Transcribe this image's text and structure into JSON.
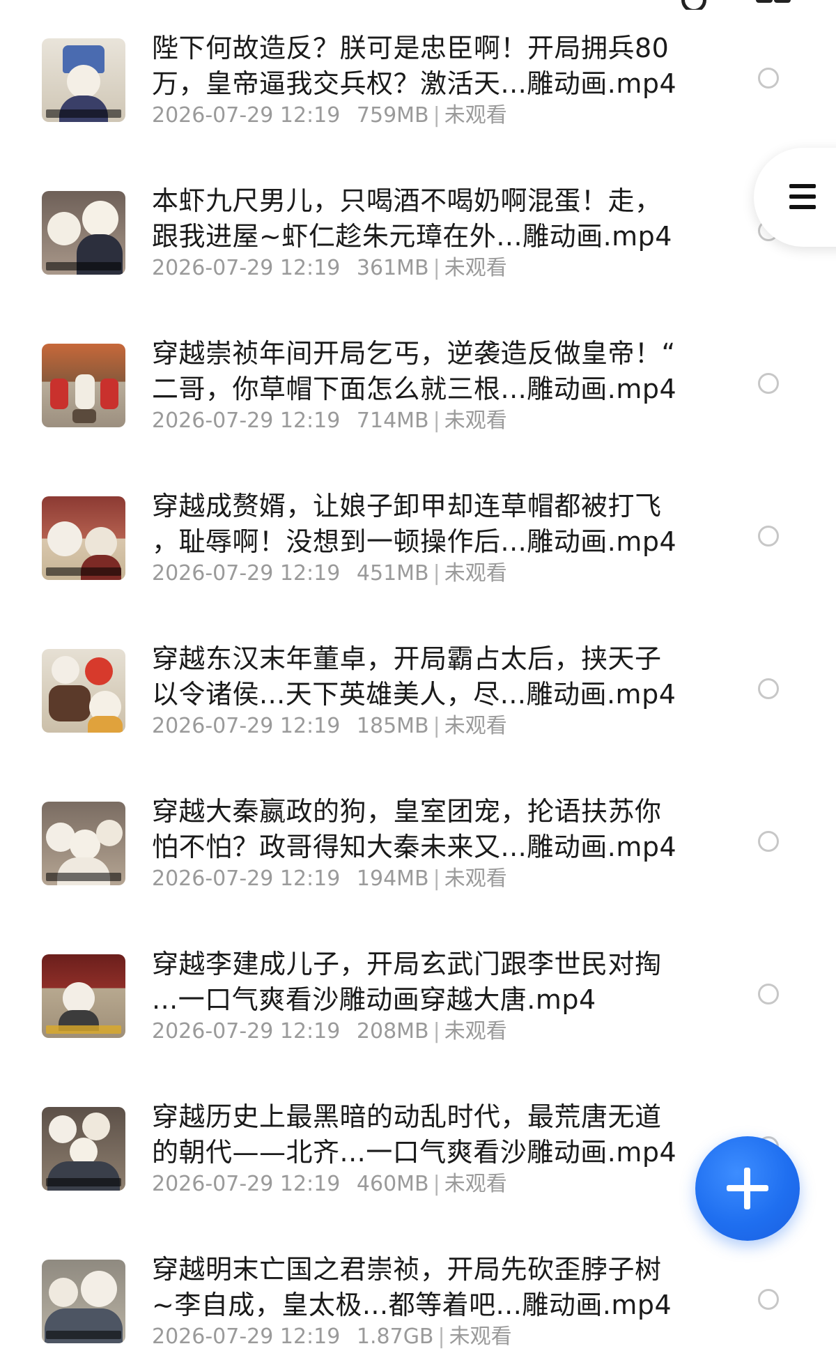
{
  "colors": {
    "title_text": "#1a1a1a",
    "meta_text": "#9a9a9a",
    "radio_border": "#c7c7c7",
    "fab_blue": "#1f6ff0"
  },
  "icons": {
    "side_menu": "menu-icon",
    "fab": "plus-icon",
    "top_search": "search-icon",
    "top_grid": "grid-icon"
  },
  "files": [
    {
      "title_line1": "陛下何故造反？朕可是忠臣啊！开局拥兵80",
      "title_line2": "万，皇帝逼我交兵权？激活天...雕动画.mp4",
      "date": "2026-07-29 12:19",
      "size": "759MB",
      "status": "未观看"
    },
    {
      "title_line1": "本虾九尺男儿，只喝酒不喝奶啊混蛋！走，",
      "title_line2": "跟我进屋~虾仁趁朱元璋在外...雕动画.mp4",
      "date": "2026-07-29 12:19",
      "size": "361MB",
      "status": "未观看"
    },
    {
      "title_line1": "穿越崇祯年间开局乞丐，逆袭造反做皇帝！“",
      "title_line2": "二哥，你草帽下面怎么就三根...雕动画.mp4",
      "date": "2026-07-29 12:19",
      "size": "714MB",
      "status": "未观看"
    },
    {
      "title_line1": "穿越成赘婿，让娘子卸甲却连草帽都被打飞",
      "title_line2": "，耻辱啊！没想到一顿操作后...雕动画.mp4",
      "date": "2026-07-29 12:19",
      "size": "451MB",
      "status": "未观看"
    },
    {
      "title_line1": "穿越东汉末年董卓，开局霸占太后，挟天子",
      "title_line2": "以令诸侯...天下英雄美人，尽...雕动画.mp4",
      "date": "2026-07-29 12:19",
      "size": "185MB",
      "status": "未观看"
    },
    {
      "title_line1": "穿越大秦嬴政的狗，皇室团宠，抡语扶苏你",
      "title_line2": "怕不怕？政哥得知大秦未来又...雕动画.mp4",
      "date": "2026-07-29 12:19",
      "size": "194MB",
      "status": "未观看"
    },
    {
      "title_line1": "穿越李建成儿子，开局玄武门跟李世民对掏",
      "title_line2": "...一口气爽看沙雕动画穿越大唐.mp4",
      "date": "2026-07-29 12:19",
      "size": "208MB",
      "status": "未观看"
    },
    {
      "title_line1": "穿越历史上最黑暗的动乱时代，最荒唐无道",
      "title_line2": "的朝代——北齐...一口气爽看沙雕动画.mp4",
      "date": "2026-07-29 12:19",
      "size": "460MB",
      "status": "未观看"
    },
    {
      "title_line1": "穿越明末亡国之君崇祯，开局先砍歪脖子树",
      "title_line2": "~李自成，皇太极...都等着吧...雕动画.mp4",
      "date": "2026-07-29 12:19",
      "size": "1.87GB",
      "status": "未观看"
    }
  ]
}
